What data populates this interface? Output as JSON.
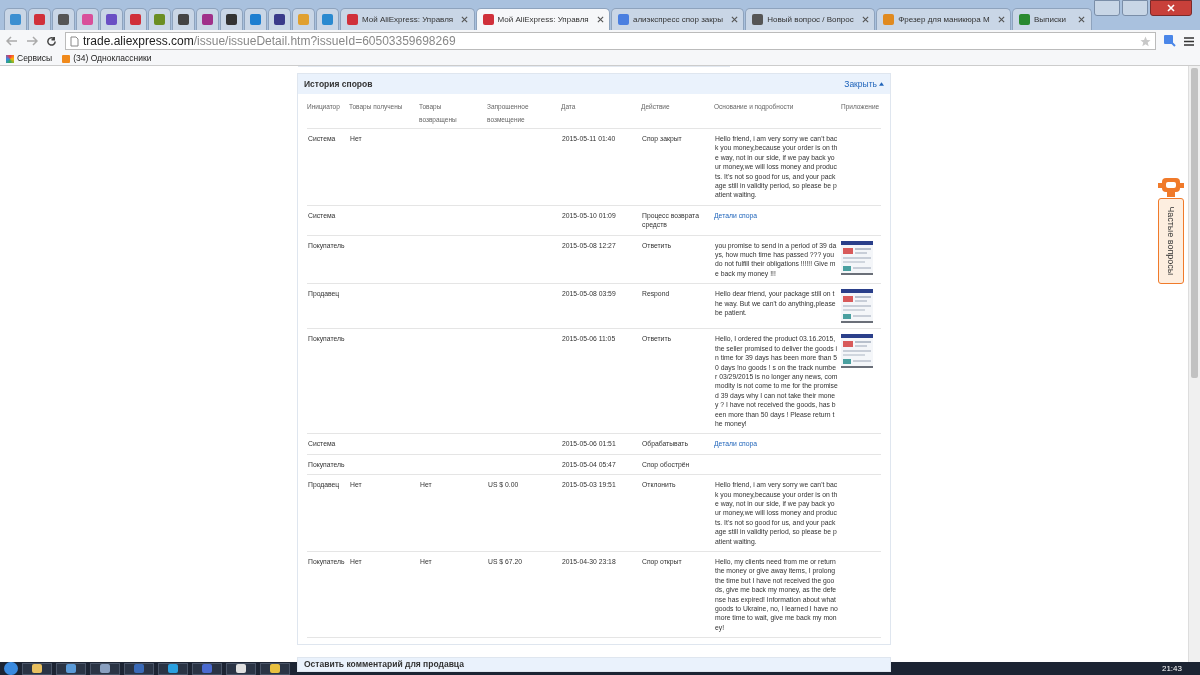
{
  "browser": {
    "tabs": [
      {
        "selected": false,
        "color": "#3b8fd1"
      },
      {
        "selected": false,
        "color": "#d0303a"
      },
      {
        "selected": false,
        "color": "#555555"
      },
      {
        "selected": false,
        "color": "#d94f9a"
      },
      {
        "selected": false,
        "color": "#6a4fc4"
      },
      {
        "selected": false,
        "color": "#d0303a"
      },
      {
        "selected": false,
        "color": "#6b8e23"
      },
      {
        "selected": false,
        "color": "#444444"
      },
      {
        "selected": false,
        "color": "#a0308a"
      },
      {
        "selected": false,
        "color": "#333333"
      },
      {
        "selected": false,
        "color": "#1e7fd0"
      },
      {
        "selected": false,
        "color": "#3a3a8a"
      },
      {
        "selected": false,
        "color": "#e0a030"
      },
      {
        "selected": false,
        "color": "#2a8ad0"
      },
      {
        "title": "Мой AliExpress: Управля",
        "selected": false,
        "color": "#d0303a"
      },
      {
        "title": "Мой AliExpress: Управля",
        "selected": true,
        "color": "#d0303a"
      },
      {
        "title": "алиэкспресс спор закры",
        "selected": false,
        "color": "#4a7fe0"
      },
      {
        "title": "Новый вопрос / Вопрос",
        "selected": false,
        "color": "#555555"
      },
      {
        "title": "Фрезер для маникюра М",
        "selected": false,
        "color": "#e08a20"
      },
      {
        "title": "Выписки",
        "selected": false,
        "color": "#2a8a30"
      }
    ],
    "url_host": "trade.aliexpress.com",
    "url_path": "/issue/issueDetail.htm?issueId=60503359698269",
    "bookmarks": [
      {
        "label": "Сервисы"
      },
      {
        "label": "(34) Одноклассники"
      }
    ]
  },
  "history": {
    "title": "История споров",
    "toggle": "Закрыть",
    "columns": [
      "Инициатор",
      "Товары получены",
      "Товары возвращены",
      "Запрошенное возмещение",
      "Дата",
      "Действие",
      "Основание и подробности",
      "Приложение"
    ],
    "rows": [
      {
        "initiator": "Система",
        "received": "Нет",
        "returned": "",
        "refund": "",
        "date": "2015-05-11 01:40",
        "action": "Спор закрыт",
        "details": {
          "kind": "text",
          "text": "Hello friend, i am very sorry we can't back you money,because your order is on the way, not in our side, if we pay back your money,we will loss money and products. It's not so good for us, and your package still in validity period, so please be patient waiting."
        }
      },
      {
        "initiator": "Система",
        "received": "",
        "returned": "",
        "refund": "",
        "date": "2015-05-10 01:09",
        "action": "Процесс возврата средств",
        "details": {
          "kind": "link",
          "text": "Детали спора"
        }
      },
      {
        "initiator": "Покупатель",
        "received": "",
        "returned": "",
        "refund": "",
        "date": "2015-05-08 12:27",
        "action": "Ответить",
        "details": {
          "kind": "text",
          "text": "you promise to send in a period of 39 days, how much time has passed ??? you do not fulfill their obligations !!!!!! Give me back my money !!!"
        }
      },
      {
        "initiator": "Продавец",
        "received": "",
        "returned": "",
        "refund": "",
        "date": "2015-05-08 03:59",
        "action": "Respond",
        "details": {
          "kind": "text",
          "text": "Hello dear friend, your package still on the way. But we can't do anything,please be patient."
        }
      },
      {
        "initiator": "Покупатель",
        "received": "",
        "returned": "",
        "refund": "",
        "date": "2015-05-06 11:05",
        "action": "Ответить",
        "details": {
          "kind": "text",
          "text": "Hello, I ordered the product 03.16.2015, the seller promised to deliver the goods in time for 39 days has been more than 50 days !no goods ! s on the track number 03/29/2015 is no longer any news, commodity is not come to me for the promised 39 days why I can not take their money ? I have not received the goods, has been more than 50 days ! Please return the money!"
        }
      },
      {
        "initiator": "Система",
        "received": "",
        "returned": "",
        "refund": "",
        "date": "2015-05-06 01:51",
        "action": "Обрабатывать",
        "details": {
          "kind": "link",
          "text": "Детали спора"
        }
      },
      {
        "initiator": "Покупатель",
        "received": "",
        "returned": "",
        "refund": "",
        "date": "2015-05-04 05:47",
        "action": "Спор обострён"
      },
      {
        "initiator": "Продавец",
        "received": "Нет",
        "returned": "Нет",
        "refund": "US $ 0.00",
        "date": "2015-05-03 19:51",
        "action": "Отклонить",
        "details": {
          "kind": "text",
          "text": "Hello friend, i am very sorry we can't back you money,because your order is on the way, not in our side, if we pay back your money,we will loss money and products. It's not so good for us, and your package still in validity period, so please be patient waiting."
        }
      },
      {
        "initiator": "Покупатель",
        "received": "Нет",
        "returned": "Нет",
        "refund": "US $ 67.20",
        "date": "2015-04-30 23:18",
        "action": "Спор открыт",
        "details": {
          "kind": "text",
          "text": "Hello, my clients need from me or return the money or give away items, I prolong the time but I have not received the goods, give me back my money, as the defense has expired! Information about what goods to Ukraine, no, I learned I have no more time to wait, give me back my money!"
        }
      }
    ]
  },
  "comment_section": {
    "title": "Оставить комментарий для продавца"
  },
  "help_tab": {
    "label": "Частые вопросы"
  },
  "taskbar": {
    "clock": "21:43"
  }
}
